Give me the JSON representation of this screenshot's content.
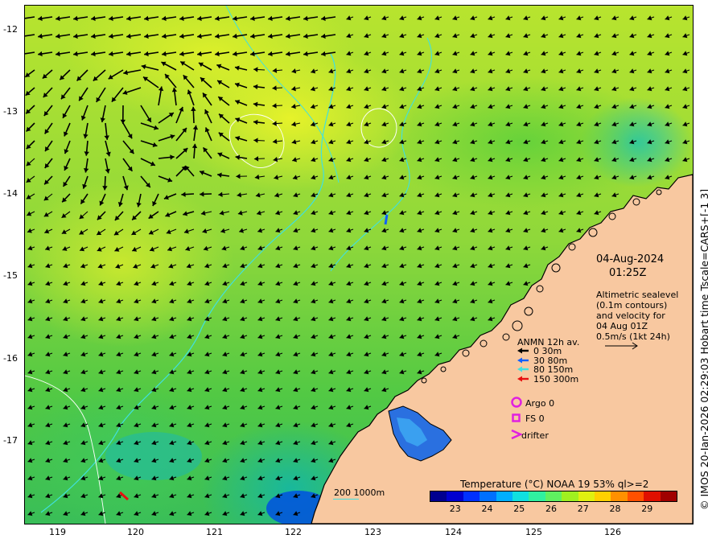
{
  "axes": {
    "x_ticks": [
      "119",
      "120",
      "121",
      "122",
      "123",
      "124",
      "125",
      "126"
    ],
    "y_ticks": [
      "-12",
      "-13",
      "-14",
      "-15",
      "-16",
      "-17"
    ]
  },
  "credit": "© IMOS 20-Jan-2026 02:29:03 Hobart time Tscale=CARS+[-1 3]",
  "datetime": {
    "date": "04-Aug-2024",
    "time": "01:25Z"
  },
  "altimetry_note": {
    "lines": [
      "Altimetric sealevel",
      "(0.1m contours)",
      "and velocity for",
      "04 Aug 01Z",
      "0.5m/s (1kt 24h)"
    ]
  },
  "anmn_legend": {
    "title": "ANMN 12h av.",
    "items": [
      {
        "label": "0 30m",
        "color": "#000000"
      },
      {
        "label": "30 80m",
        "color": "#1060ff"
      },
      {
        "label": "80 150m",
        "color": "#40e0e0"
      },
      {
        "label": "150 300m",
        "color": "#e81010"
      }
    ]
  },
  "markers_legend": [
    {
      "label": "Argo 0",
      "symbol": "circle",
      "color": "#e020e0"
    },
    {
      "label": "FS 0",
      "symbol": "square",
      "color": "#e020e0"
    },
    {
      "label": "drifter",
      "symbol": "chevron",
      "color": "#e020e0"
    }
  ],
  "isobath_legend": "200  1000m",
  "colorbar": {
    "title": "Temperature (°C) NOAA 19 53% ql>=2",
    "ticks": [
      "23",
      "24",
      "25",
      "26",
      "27",
      "28",
      "29"
    ],
    "range_c": [
      22.2,
      29.9
    ],
    "colors": [
      "#00008f",
      "#0000cf",
      "#0030ff",
      "#0070ff",
      "#00afff",
      "#10e0e0",
      "#30f0a0",
      "#60f060",
      "#a0f020",
      "#e0f010",
      "#ffd000",
      "#ff9000",
      "#ff5000",
      "#e01000",
      "#a00000"
    ]
  },
  "map_colors": {
    "land": "#f8c8a0",
    "coast": "#000000",
    "isobath_200": "#40e0e0",
    "ssh_contour": "#ffffff",
    "vector": "#000000"
  }
}
